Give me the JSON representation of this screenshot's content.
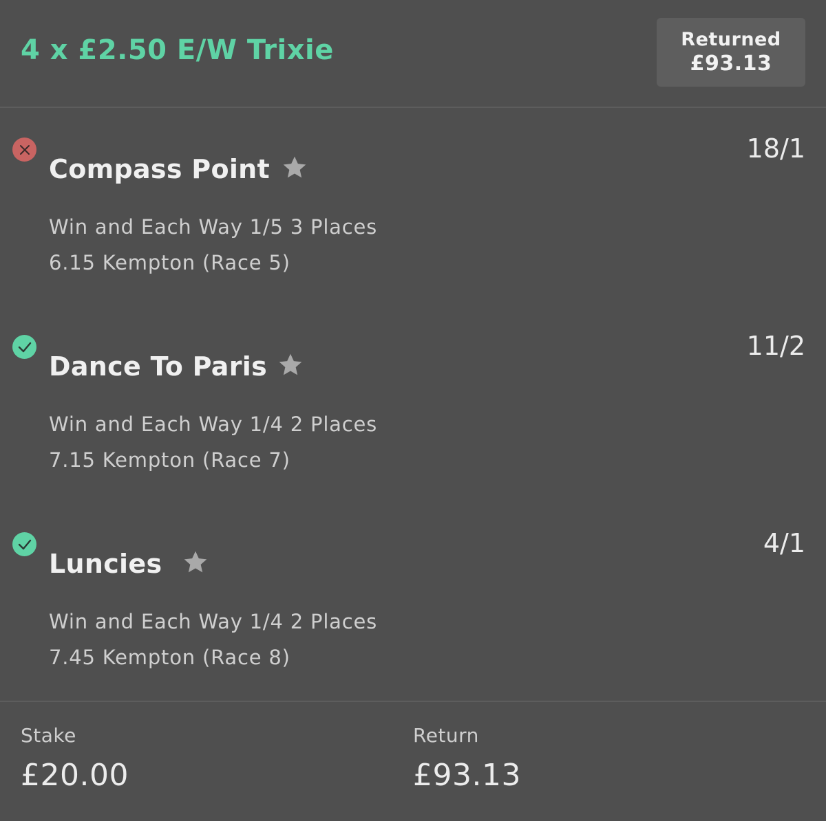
{
  "header": {
    "bet_title": "4 x £2.50 E/W Trixie",
    "returned_label": "Returned",
    "returned_amount": "£93.13"
  },
  "selections": [
    {
      "status": "lost",
      "status_icon": "cross-icon",
      "name": "Compass Point",
      "odds": "18/1",
      "market": "Win and Each Way 1/5 3 Places",
      "race": "6.15 Kempton (Race 5)"
    },
    {
      "status": "won",
      "status_icon": "check-icon",
      "name": "Dance To Paris",
      "odds": "11/2",
      "market": "Win and Each Way 1/4 2 Places",
      "race": "7.15 Kempton (Race 7)"
    },
    {
      "status": "won",
      "status_icon": "check-icon",
      "name": "Luncies",
      "odds": "4/1",
      "market": "Win and Each Way 1/4 2 Places",
      "race": "7.45 Kempton (Race 8)"
    }
  ],
  "footer": {
    "stake_label": "Stake",
    "stake_value": "£20.00",
    "return_label": "Return",
    "return_value": "£93.13"
  },
  "colors": {
    "background": "#4f4f4f",
    "accent_green": "#5fd3a5",
    "lost_red": "#c96462",
    "badge_bg": "#5e5e5e"
  }
}
